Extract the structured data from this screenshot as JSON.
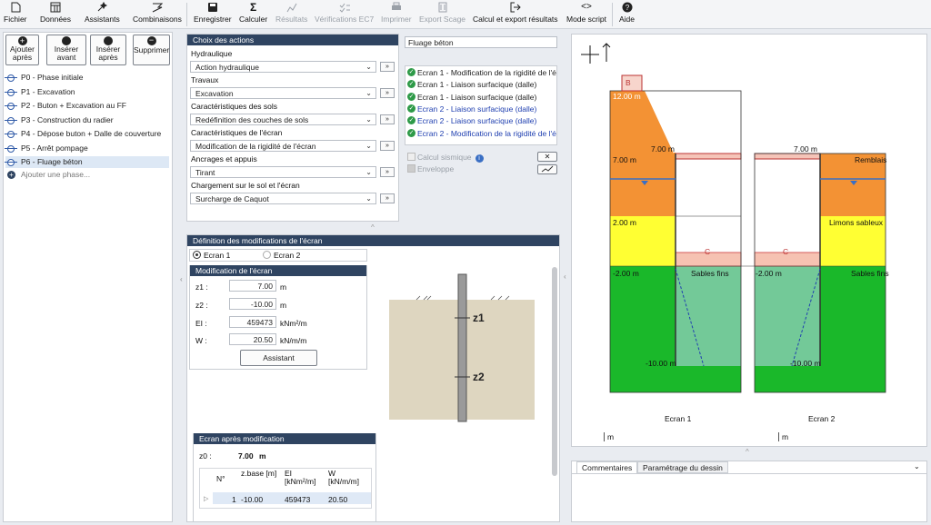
{
  "toolbar": {
    "fichier": "Fichier",
    "donnees": "Données",
    "assistants": "Assistants",
    "combinaisons": "Combinaisons",
    "enregistrer": "Enregistrer",
    "calculer": "Calculer",
    "resultats": "Résultats",
    "verifications": "Vérifications EC7",
    "imprimer": "Imprimer",
    "export_scage": "Export Scage",
    "calcul_export": "Calcul et export résultats",
    "mode_script": "Mode script",
    "aide": "Aide"
  },
  "phase_buttons": {
    "ajouter_apres": "Ajouter après",
    "inserer_avant": "Insérer avant",
    "inserer_apres": "Insérer après",
    "supprimer": "Supprimer"
  },
  "phases": [
    "P0 - Phase initiale",
    "P1 - Excavation",
    "P2 - Buton + Excavation au FF",
    "P3 - Construction du radier",
    "P4 - Dépose buton + Dalle de couverture",
    "P5 - Arrêt pompage",
    "P6 - Fluage béton"
  ],
  "add_phase": "Ajouter une phase...",
  "actions": {
    "title": "Choix des actions",
    "groups": [
      {
        "label": "Hydraulique",
        "value": "Action hydraulique"
      },
      {
        "label": "Travaux",
        "value": "Excavation"
      },
      {
        "label": "Caractéristiques des sols",
        "value": "Redéfinition des couches de sols"
      },
      {
        "label": "Caractéristiques de l'écran",
        "value": "Modification de la rigidité de l'écran"
      },
      {
        "label": "Ancrages et appuis",
        "value": "Tirant"
      },
      {
        "label": "Chargement sur le sol et l'écran",
        "value": "Surcharge de Caquot"
      }
    ]
  },
  "phase_name": "Fluage béton",
  "action_list": [
    {
      "text": "Ecran 1 - Modification de la rigidité de l'é",
      "blue": false
    },
    {
      "text": "Ecran 1 - Liaison surfacique (dalle)",
      "blue": false
    },
    {
      "text": "Ecran 1 - Liaison surfacique (dalle)",
      "blue": false
    },
    {
      "text": "Ecran 2 - Liaison surfacique (dalle)",
      "blue": true
    },
    {
      "text": "Ecran 2 - Liaison surfacique (dalle)",
      "blue": true
    },
    {
      "text": "Ecran 2 - Modification de la rigidité de l'é",
      "blue": true
    }
  ],
  "calcul_sismique": "Calcul sismique",
  "enveloppe": "Enveloppe",
  "modif": {
    "title": "Définition des modifications de l'écran",
    "ecran1": "Ecran 1",
    "ecran2": "Ecran 2",
    "sub_title": "Modification de l'écran",
    "z1_label": "z1 :",
    "z1": "7.00",
    "z1_unit": "m",
    "z2_label": "z2 :",
    "z2": "-10.00",
    "z2_unit": "m",
    "ei_label": "EI :",
    "ei": "459473",
    "ei_unit": "kNm²/m",
    "w_label": "W :",
    "w": "20.50",
    "w_unit": "kN/m/m",
    "assistant": "Assistant",
    "diag_z1": "z1",
    "diag_z2": "z2"
  },
  "apres": {
    "title": "Ecran après modification",
    "z0_label": "z0 :",
    "z0": "7.00",
    "z0_unit": "m",
    "cols": [
      "N°",
      "z.base [m]",
      "EI [kNm²/m]",
      "W [kN/m/m]"
    ],
    "row": [
      "1",
      "-10.00",
      "459473",
      "20.50"
    ]
  },
  "drawing": {
    "top_level": "12.00 m",
    "b_label": "B",
    "l7a": "7.00 m",
    "l7b": "7.00 m",
    "l7c": "7.00 m",
    "remblais": "Remblais",
    "l2": "2.00 m",
    "limons": "Limons sableux",
    "lm2a": "-2.00 m",
    "lm2b": "-2.00 m",
    "sables_a": "Sables fins",
    "sables_b": "Sables fins",
    "c1": "C",
    "c2": "C",
    "lm10a": "-10.00 m",
    "lm10b": "-10.00 m",
    "ecran1": "Ecran 1",
    "ecran2": "Ecran 2",
    "unit_a": "m",
    "unit_b": "m"
  },
  "bottom_tabs": [
    "Commentaires",
    "Paramétrage du dessin"
  ]
}
